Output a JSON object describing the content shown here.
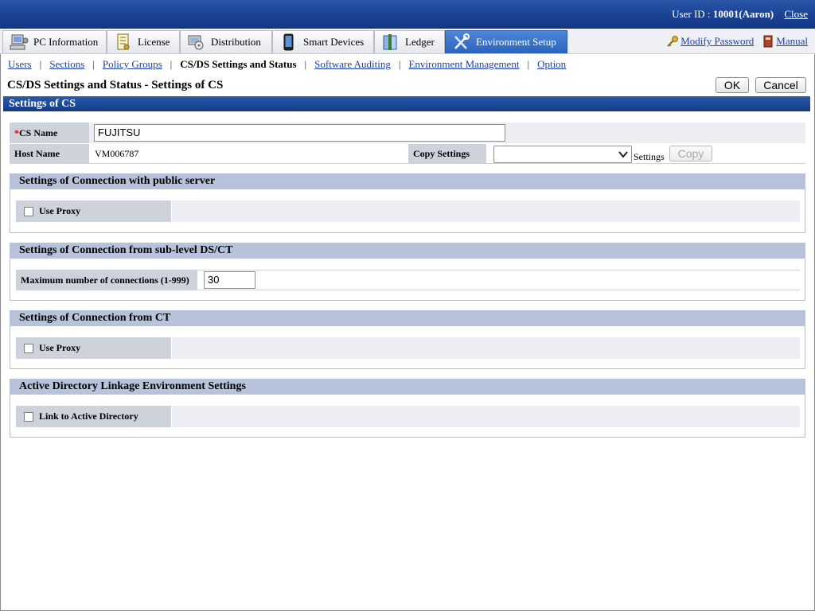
{
  "header": {
    "user_id_label": "User ID :",
    "user_id_value": "10001(Aaron)",
    "close_link": "Close"
  },
  "tabs": [
    {
      "label": "PC Information",
      "icon": "pc-icon"
    },
    {
      "label": "License",
      "icon": "license-icon"
    },
    {
      "label": "Distribution",
      "icon": "distribution-icon"
    },
    {
      "label": "Smart Devices",
      "icon": "smart-device-icon"
    },
    {
      "label": "Ledger",
      "icon": "ledger-icon"
    },
    {
      "label": "Environment Setup",
      "icon": "tools-icon",
      "active": true
    }
  ],
  "top_links": {
    "modify_password": "Modify Password",
    "manual": "Manual"
  },
  "subnav": [
    {
      "label": "Users",
      "link": true
    },
    {
      "label": "Sections",
      "link": true
    },
    {
      "label": "Policy Groups",
      "link": true
    },
    {
      "label": "CS/DS Settings and Status",
      "link": false
    },
    {
      "label": "Software Auditing",
      "link": true
    },
    {
      "label": "Environment Management",
      "link": true
    },
    {
      "label": "Option",
      "link": true
    }
  ],
  "page_title": "CS/DS Settings and Status - Settings of CS",
  "buttons": {
    "ok": "OK",
    "cancel": "Cancel",
    "copy": "Copy"
  },
  "section_title": "Settings of CS",
  "form": {
    "cs_name_required_mark": "*",
    "cs_name_label": "CS Name",
    "cs_name_value": "FUJITSU",
    "host_name_label": "Host Name",
    "host_name_value": "VM006787",
    "copy_settings_label": "Copy Settings",
    "copy_settings_value": "",
    "copy_settings_suffix": "Settings"
  },
  "groups": {
    "public_server": {
      "title": "Settings of Connection with public server",
      "use_proxy": "Use Proxy"
    },
    "sub_level": {
      "title": "Settings of Connection from sub-level DS/CT",
      "max_label": "Maximum number of connections (1-999)",
      "max_value": "30"
    },
    "from_ct": {
      "title": "Settings of Connection from CT",
      "use_proxy": "Use Proxy"
    },
    "ad": {
      "title": "Active Directory Linkage Environment Settings",
      "link_label": "Link to Active Directory"
    }
  },
  "colors": {
    "accent": "#1c4596",
    "link": "#1f3fa8",
    "required": "#dd0000"
  }
}
